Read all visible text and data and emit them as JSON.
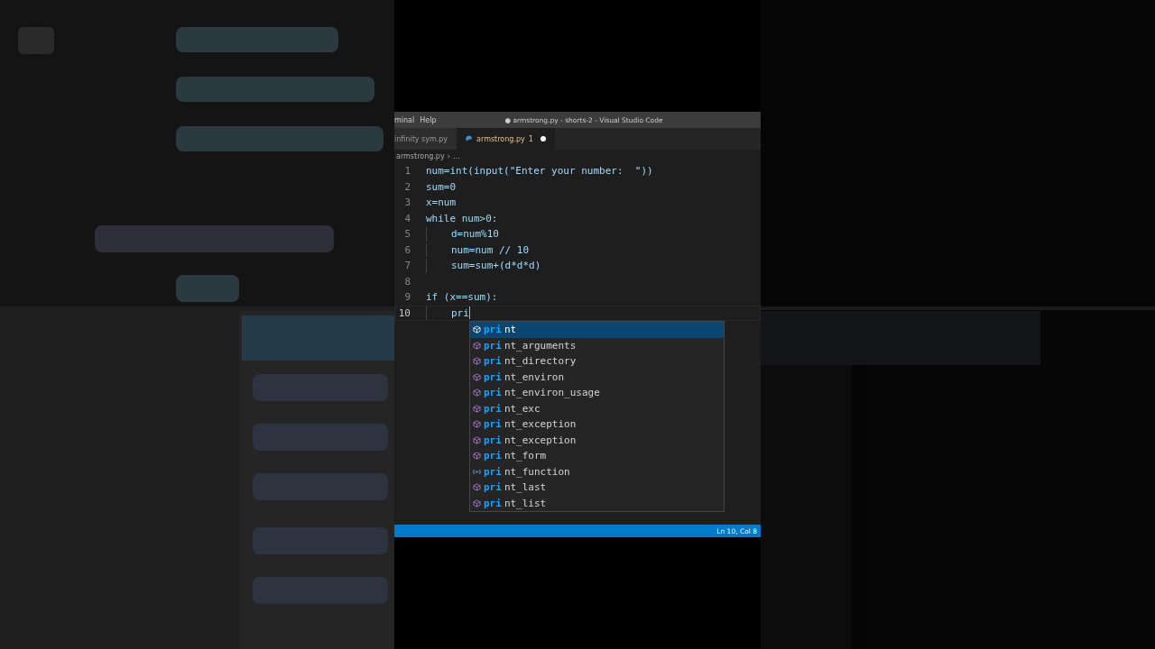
{
  "menu": [
    "minal",
    "Help"
  ],
  "window": {
    "title": "● armstrong.py - shorts-2 - Visual Studio Code"
  },
  "tabs": [
    {
      "label": "infinity sym.py",
      "selected": false,
      "modified": false
    },
    {
      "label": "armstrong.py",
      "selected": true,
      "modified": true,
      "badge": "1"
    }
  ],
  "breadcrumb": [
    "armstrong.py",
    "›",
    "…"
  ],
  "code": [
    {
      "number": "1",
      "current": false,
      "text": "num=int(input(\"Enter your number:  \"))"
    },
    {
      "number": "2",
      "current": false,
      "text": "sum=0"
    },
    {
      "number": "3",
      "current": false,
      "text": "x=num"
    },
    {
      "number": "4",
      "current": false,
      "text": "while num>0:",
      "children": [
        {
          "number": "5",
          "current": false,
          "text": "d=num%10"
        },
        {
          "number": "6",
          "current": false,
          "text": "num=num // 10"
        },
        {
          "number": "7",
          "current": false,
          "text": "sum=sum+(d*d*d)"
        }
      ]
    },
    {
      "number": "8",
      "current": false
    },
    {
      "number": "9",
      "current": false,
      "text": "if (x==sum):",
      "children": [
        {
          "number": "10",
          "current": true,
          "text": "pri"
        }
      ]
    }
  ],
  "suggestions": [
    {
      "match": "pri",
      "rest": "nt",
      "kind": "module",
      "selected": true
    },
    {
      "match": "pri",
      "rest": "nt_arguments",
      "kind": "module",
      "selected": false
    },
    {
      "match": "pri",
      "rest": "nt_directory",
      "kind": "module",
      "selected": false
    },
    {
      "match": "pri",
      "rest": "nt_environ",
      "kind": "module",
      "selected": false
    },
    {
      "match": "pri",
      "rest": "nt_environ_usage",
      "kind": "module",
      "selected": false
    },
    {
      "match": "pri",
      "rest": "nt_exc",
      "kind": "module",
      "selected": false
    },
    {
      "match": "pri",
      "rest": "nt_exception",
      "kind": "module",
      "selected": false
    },
    {
      "match": "pri",
      "rest": "nt_exception",
      "kind": "module",
      "selected": false
    },
    {
      "match": "pri",
      "rest": "nt_form",
      "kind": "module",
      "selected": false
    },
    {
      "match": "pri",
      "rest": "nt_function",
      "kind": "variable",
      "selected": false
    },
    {
      "match": "pri",
      "rest": "nt_last",
      "kind": "module",
      "selected": false
    },
    {
      "match": "pri",
      "rest": "nt_list",
      "kind": "module",
      "selected": false
    }
  ],
  "status_bar": {
    "position": "Ln 10, Col 8"
  }
}
